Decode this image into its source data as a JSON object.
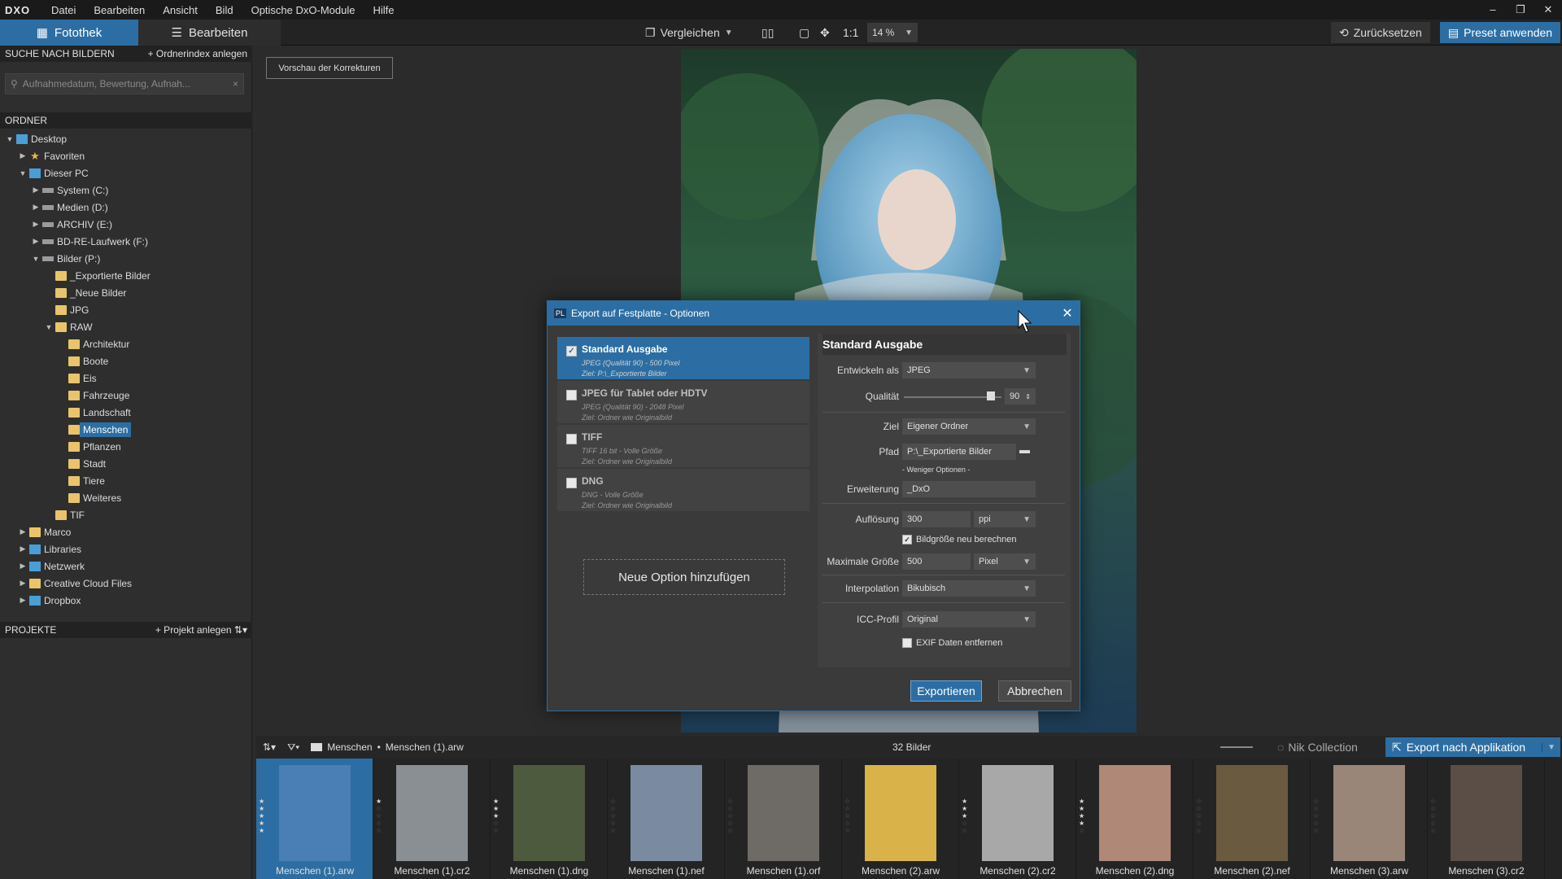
{
  "app": {
    "logo": "DXO"
  },
  "menu": [
    "Datei",
    "Bearbeiten",
    "Ansicht",
    "Bild",
    "Optische DxO-Module",
    "Hilfe"
  ],
  "tabs": {
    "fotothek": "Fotothek",
    "bearbeiten": "Bearbeiten"
  },
  "toolbar": {
    "compare": "Vergleichen",
    "one_to_one": "1:1",
    "zoom": "14 %",
    "reset": "Zurücksetzen",
    "preset": "Preset anwenden"
  },
  "search": {
    "header": "SUCHE NACH BILDERN",
    "index_link": "+ Ordnerindex anlegen",
    "placeholder": "Aufnahmedatum, Bewertung, Aufnah..."
  },
  "folders": {
    "header": "ORDNER",
    "items": [
      {
        "label": "Desktop",
        "depth": 0,
        "arrow": "▼",
        "icon": "pc"
      },
      {
        "label": "Favoriten",
        "depth": 1,
        "arrow": "▶",
        "icon": "star"
      },
      {
        "label": "Dieser PC",
        "depth": 1,
        "arrow": "▼",
        "icon": "pc"
      },
      {
        "label": "System (C:)",
        "depth": 2,
        "arrow": "▶",
        "icon": "drive"
      },
      {
        "label": "Medien (D:)",
        "depth": 2,
        "arrow": "▶",
        "icon": "drive"
      },
      {
        "label": "ARCHIV (E:)",
        "depth": 2,
        "arrow": "▶",
        "icon": "drive"
      },
      {
        "label": "BD-RE-Laufwerk (F:)",
        "depth": 2,
        "arrow": "▶",
        "icon": "drive"
      },
      {
        "label": "Bilder (P:)",
        "depth": 2,
        "arrow": "▼",
        "icon": "drive"
      },
      {
        "label": "_Exportierte Bilder",
        "depth": 3,
        "arrow": "",
        "icon": "folder"
      },
      {
        "label": "_Neue Bilder",
        "depth": 3,
        "arrow": "",
        "icon": "folder"
      },
      {
        "label": "JPG",
        "depth": 3,
        "arrow": "",
        "icon": "folder"
      },
      {
        "label": "RAW",
        "depth": 3,
        "arrow": "▼",
        "icon": "folder"
      },
      {
        "label": "Architektur",
        "depth": 4,
        "arrow": "",
        "icon": "folder"
      },
      {
        "label": "Boote",
        "depth": 4,
        "arrow": "",
        "icon": "folder"
      },
      {
        "label": "Eis",
        "depth": 4,
        "arrow": "",
        "icon": "folder"
      },
      {
        "label": "Fahrzeuge",
        "depth": 4,
        "arrow": "",
        "icon": "folder"
      },
      {
        "label": "Landschaft",
        "depth": 4,
        "arrow": "",
        "icon": "folder"
      },
      {
        "label": "Menschen",
        "depth": 4,
        "arrow": "",
        "icon": "folder",
        "selected": true
      },
      {
        "label": "Pflanzen",
        "depth": 4,
        "arrow": "",
        "icon": "folder"
      },
      {
        "label": "Stadt",
        "depth": 4,
        "arrow": "",
        "icon": "folder"
      },
      {
        "label": "Tiere",
        "depth": 4,
        "arrow": "",
        "icon": "folder"
      },
      {
        "label": "Weiteres",
        "depth": 4,
        "arrow": "",
        "icon": "folder"
      },
      {
        "label": "TIF",
        "depth": 3,
        "arrow": "",
        "icon": "folder"
      },
      {
        "label": "Marco",
        "depth": 1,
        "arrow": "▶",
        "icon": "folder"
      },
      {
        "label": "Libraries",
        "depth": 1,
        "arrow": "▶",
        "icon": "pc"
      },
      {
        "label": "Netzwerk",
        "depth": 1,
        "arrow": "▶",
        "icon": "pc"
      },
      {
        "label": "Creative Cloud Files",
        "depth": 1,
        "arrow": "▶",
        "icon": "folder"
      },
      {
        "label": "Dropbox",
        "depth": 1,
        "arrow": "▶",
        "icon": "pc"
      }
    ]
  },
  "projects": {
    "header": "PROJEKTE",
    "add_link": "+ Projekt anlegen"
  },
  "preview_button": "Vorschau der Korrekturen",
  "dialog": {
    "title": "Export auf Festplatte - Optionen",
    "options": [
      {
        "title": "Standard Ausgabe",
        "line1": "JPEG (Qualität 90)  -  500 Pixel",
        "line2": "Ziel: P:\\_Exportierte Bilder",
        "checked": true
      },
      {
        "title": "JPEG für Tablet oder HDTV",
        "line1": "JPEG (Qualität 90)  -  2048 Pixel",
        "line2": "Ziel: Ordner wie Originalbild",
        "checked": false
      },
      {
        "title": "TIFF",
        "line1": "TIFF 16 bit  -  Volle Größe",
        "line2": "Ziel: Ordner wie Originalbild",
        "checked": false
      },
      {
        "title": "DNG",
        "line1": "DNG  -  Volle Größe",
        "line2": "Ziel: Ordner wie Originalbild",
        "checked": false
      }
    ],
    "add_option": "Neue Option hinzufügen",
    "settings": {
      "title": "Standard Ausgabe",
      "entwickeln_label": "Entwickeln als",
      "entwickeln_value": "JPEG",
      "qualitaet_label": "Qualität",
      "qualitaet_value": "90",
      "ziel_label": "Ziel",
      "ziel_value": "Eigener Ordner",
      "pfad_label": "Pfad",
      "pfad_value": "P:\\_Exportierte Bilder",
      "less_options": "- Weniger Optionen -",
      "erweiterung_label": "Erweiterung",
      "erweiterung_value": "_DxO",
      "aufloesung_label": "Auflösung",
      "aufloesung_value": "300",
      "aufloesung_unit": "ppi",
      "resize_label": "Bildgröße neu berechnen",
      "maxsize_label": "Maximale Größe",
      "maxsize_value": "500",
      "maxsize_unit": "Pixel",
      "interp_label": "Interpolation",
      "interp_value": "Bikubisch",
      "icc_label": "ICC-Profil",
      "icc_value": "Original",
      "exif_label": "EXIF Daten entfernen"
    },
    "export_btn": "Exportieren",
    "cancel_btn": "Abbrechen"
  },
  "filmstrip": {
    "breadcrumb_folder": "Menschen",
    "breadcrumb_file": "Menschen (1).arw",
    "count": "32 Bilder",
    "nik": "Nik Collection",
    "export_app": "Export nach Applikation",
    "thumbs": [
      {
        "name": "Menschen (1).arw",
        "color": "#4a7fb5",
        "stars": 5
      },
      {
        "name": "Menschen (1).cr2",
        "color": "#8a8f94",
        "stars": 1
      },
      {
        "name": "Menschen (1).dng",
        "color": "#4e5a3e",
        "stars": 3
      },
      {
        "name": "Menschen (1).nef",
        "color": "#7a8aa0",
        "stars": 0
      },
      {
        "name": "Menschen (1).orf",
        "color": "#6e6a66",
        "stars": 0
      },
      {
        "name": "Menschen (2).arw",
        "color": "#d9b24a",
        "stars": 0
      },
      {
        "name": "Menschen (2).cr2",
        "color": "#a8a8a8",
        "stars": 3
      },
      {
        "name": "Menschen (2).dng",
        "color": "#b08878",
        "stars": 4
      },
      {
        "name": "Menschen (2).nef",
        "color": "#6a5a40",
        "stars": 0
      },
      {
        "name": "Menschen (3).arw",
        "color": "#9a8678",
        "stars": 0
      },
      {
        "name": "Menschen (3).cr2",
        "color": "#5a4e46",
        "stars": 0
      }
    ]
  }
}
